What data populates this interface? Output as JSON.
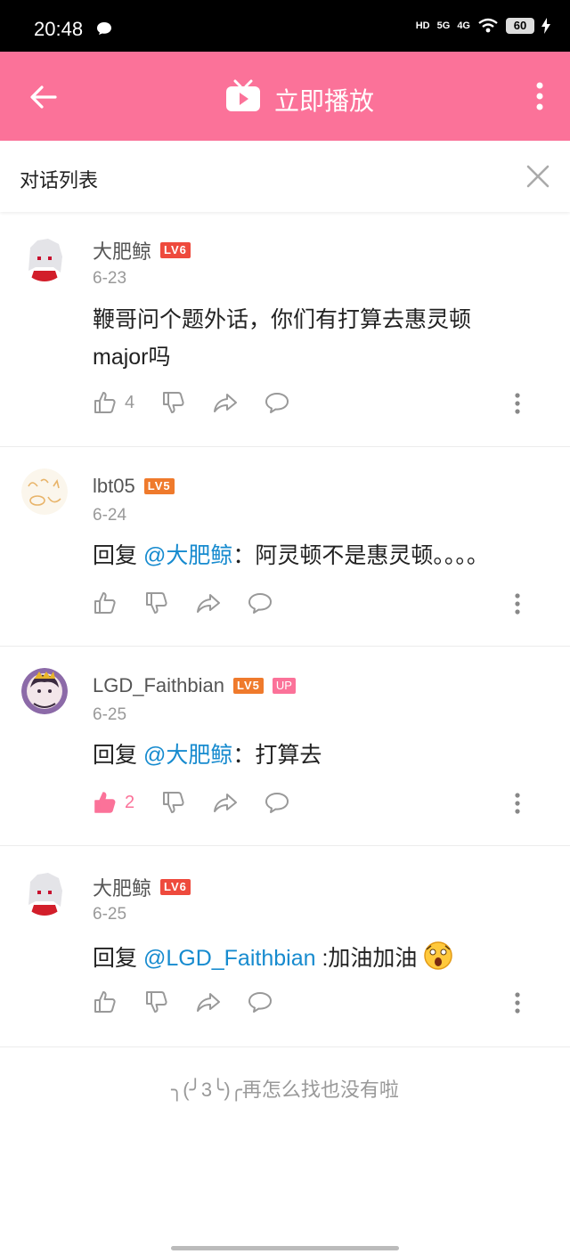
{
  "status_bar": {
    "time": "20:48",
    "hd": "HD",
    "sig1": "5G",
    "sig2": "4G",
    "battery": "60"
  },
  "header": {
    "title": "立即播放",
    "accent": "#fb7299"
  },
  "dialog": {
    "title": "对话列表"
  },
  "comments": [
    {
      "user": "大肥鲸",
      "level": "LV6",
      "date": "6-23",
      "text": "鞭哥问个题外话，你们有打算去惠灵顿major吗",
      "likes": "4"
    },
    {
      "user": "lbt05",
      "level": "LV5",
      "date": "6-24",
      "reply_prefix": "回复",
      "mention": "@大肥鲸",
      "text": "：阿灵顿不是惠灵顿。。。。",
      "likes": ""
    },
    {
      "user": "LGD_Faithbian",
      "level": "LV5",
      "badge": "UP",
      "date": "6-25",
      "reply_prefix": "回复",
      "mention": "@大肥鲸",
      "text": "：打算去",
      "likes": "2"
    },
    {
      "user": "大肥鲸",
      "level": "LV6",
      "date": "6-25",
      "reply_prefix": "回复",
      "mention": "@LGD_Faithbian",
      "text": " :加油加油",
      "likes": ""
    }
  ],
  "footer": {
    "note": "╮(╯3╰)╭再怎么找也没有啦"
  }
}
